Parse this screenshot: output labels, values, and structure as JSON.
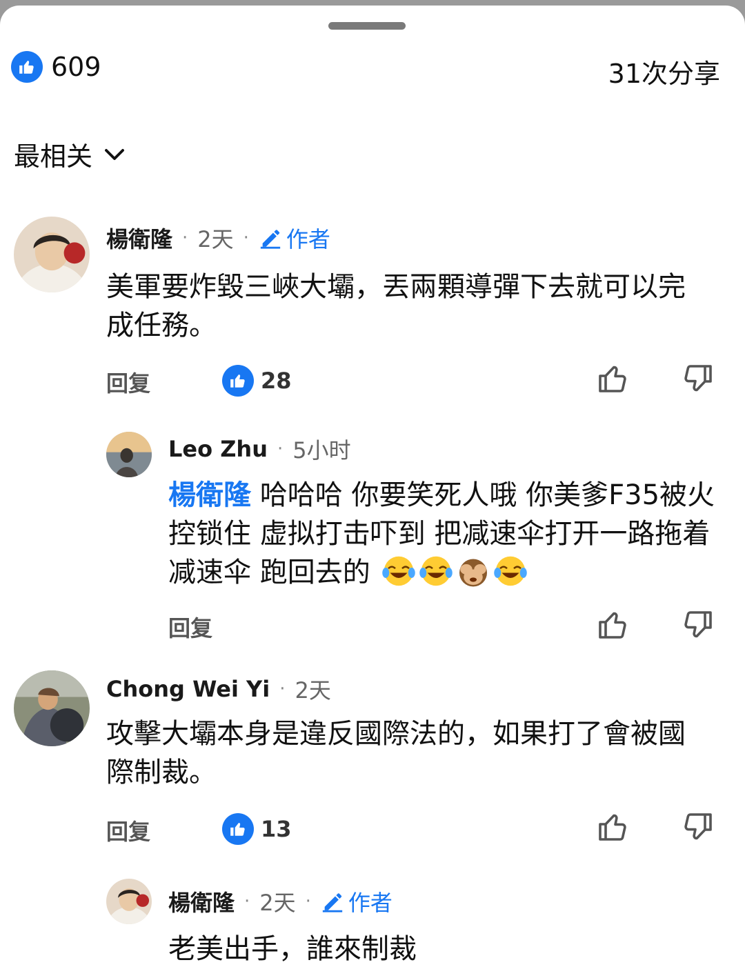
{
  "summary": {
    "likes": "609",
    "shares": "31次分享"
  },
  "sort": {
    "label": "最相关"
  },
  "comments": [
    {
      "name": "楊衛隆",
      "time": "2天",
      "author_label": "作者",
      "text": "美軍要炸毀三峽大壩，丟兩顆導彈下去就可以完成任務。",
      "reply": "回复",
      "likes": "28"
    },
    {
      "name": "Leo Zhu",
      "time": "5小时",
      "mention": "楊衛隆",
      "text": " 哈哈哈 你要笑死人哦 你美爹F35被火控锁住 虚拟打击吓到 把减速伞打开一路拖着减速伞 跑回去的 ",
      "emojis": [
        "tears-of-joy-emoji",
        "tears-of-joy-emoji",
        "see-no-evil-monkey-emoji",
        "tears-of-joy-emoji"
      ],
      "reply": "回复"
    },
    {
      "name": "Chong Wei Yi",
      "time": "2天",
      "text": "攻擊大壩本身是違反國際法的，如果打了會被國際制裁。",
      "reply": "回复",
      "likes": "13"
    },
    {
      "name": "楊衛隆",
      "time": "2天",
      "author_label": "作者",
      "text": "老美出手，誰來制裁"
    }
  ],
  "colors": {
    "accent": "#1877f2",
    "text": "#111111",
    "muted": "#666666"
  }
}
